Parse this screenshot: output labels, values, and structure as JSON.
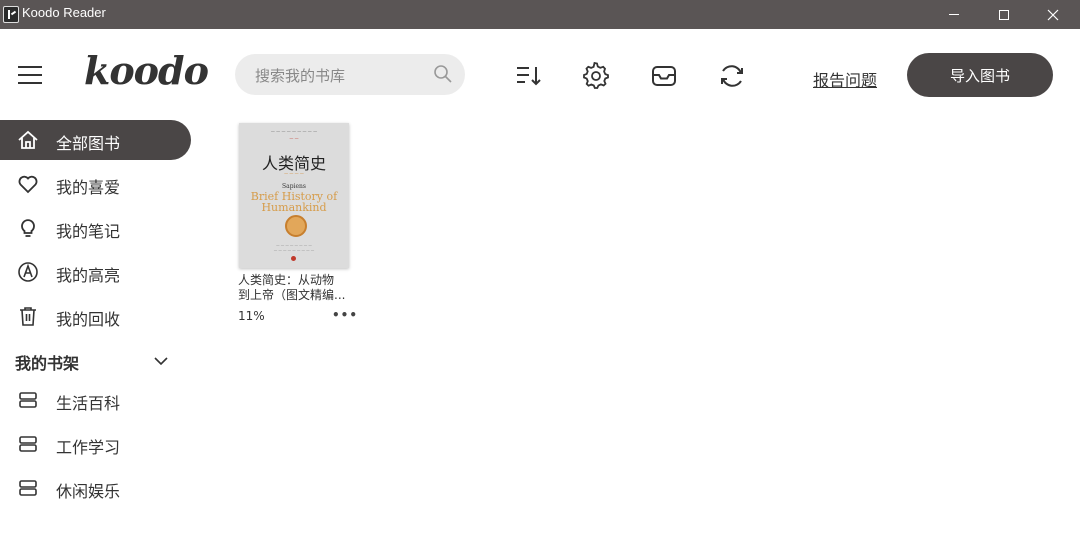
{
  "window": {
    "title": "Koodo Reader"
  },
  "header": {
    "logo": "koodo",
    "search_placeholder": "搜索我的书库",
    "report_label": "报告问题",
    "import_label": "导入图书",
    "icons": [
      "sort-icon",
      "settings-icon",
      "inbox-icon",
      "sync-icon"
    ]
  },
  "sidebar": {
    "items": [
      {
        "label": "全部图书",
        "icon": "home-icon",
        "active": true
      },
      {
        "label": "我的喜爱",
        "icon": "heart-icon",
        "active": false
      },
      {
        "label": "我的笔记",
        "icon": "bulb-icon",
        "active": false
      },
      {
        "label": "我的高亮",
        "icon": "highlight-icon",
        "active": false
      },
      {
        "label": "我的回收",
        "icon": "trash-icon",
        "active": false
      }
    ],
    "shelf_title": "我的书架",
    "shelves": [
      {
        "label": "生活百科",
        "icon": "shelf-icon"
      },
      {
        "label": "工作学习",
        "icon": "shelf-icon"
      },
      {
        "label": "休闲娱乐",
        "icon": "shelf-icon"
      }
    ]
  },
  "books": [
    {
      "name_line1": "人类简史：从动物",
      "name_line2": "到上帝（图文精编...",
      "progress": "11%",
      "more": "•••",
      "cover": {
        "title": "人类简史",
        "sapiens": "Sapiens",
        "english_line1": "Brief History of",
        "english_line2": "Humankind"
      }
    }
  ],
  "colors": {
    "titlebar": "#5a5555",
    "accent": "#4a4646",
    "background": "#ffffff"
  }
}
